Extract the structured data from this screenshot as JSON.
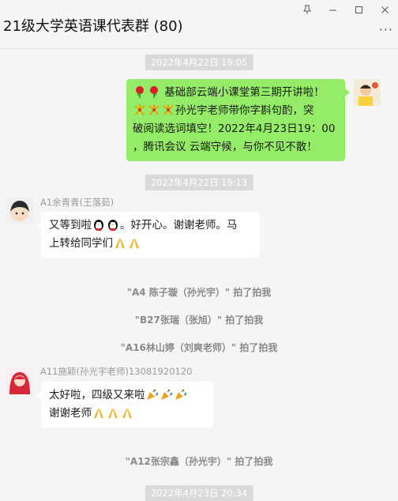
{
  "window": {
    "title": "21级大学英语课代表群 (80)",
    "pin": "⊼",
    "minimize": "—",
    "maximize": "☐",
    "close": "✕",
    "more": "···"
  },
  "colors": {
    "mine_bubble": "#95ec69",
    "other_bubble": "#ffffff",
    "timestamp_bg": "#dadada",
    "background": "#f5f5f5"
  },
  "messages": {
    "ts1": "2022年4月22日 19:05",
    "msg1_text_a": "基础部云端小课堂第三期开讲啦！",
    "msg1_text_b": "孙光宇老师带你字斟句酌，突",
    "msg1_text_c": "破阅读选词填空！2022年4月23日19：00",
    "msg1_text_d": "，腾讯会议 云端守候，与你不见不散！",
    "ts2": "2022年4月22日 19:13",
    "sender2": "A1余青青(王落茹)",
    "msg2_text_a": "又等到啦",
    "msg2_text_b": "。好开心。谢谢老师。马",
    "msg2_text_c": "上转给同学们",
    "sys1": "\"A4 陈子璇（孙光宇）\" 拍了拍我",
    "sys2": "\"B27张瑞（张旭）\" 拍了拍我",
    "sys3": "\"A16林山婷（刘爽老师）\" 拍了拍我",
    "sender3": "A11施颖(孙光宇老师)13081920120",
    "msg3_text_a": "太好啦，四级又来啦",
    "msg3_text_b": "谢谢老师",
    "sys4": "\"A12张宗鑫（孙光宇）\" 拍了拍我",
    "ts3": "2022年4月23日 20:34"
  },
  "icons": [
    "rose-icon",
    "fireworks-icon",
    "penguin-icon",
    "pray-icon",
    "party-popper-icon",
    "pin-icon",
    "minimize-icon",
    "maximize-icon",
    "close-icon",
    "more-icon"
  ]
}
